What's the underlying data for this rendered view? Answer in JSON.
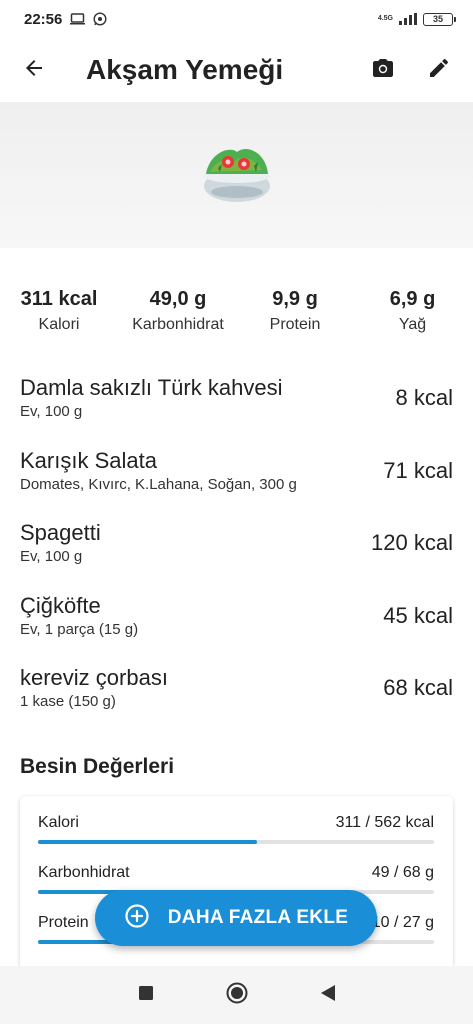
{
  "status_bar": {
    "time": "22:56",
    "network_label": "4.5G",
    "battery": "35",
    "icons": [
      "screen-icon",
      "whatsapp-icon",
      "signal-icon",
      "battery-icon"
    ]
  },
  "app_bar": {
    "title": "Akşam Yemeği",
    "icons": [
      "back-arrow-icon",
      "camera-icon",
      "edit-pencil-icon"
    ]
  },
  "hero": {
    "icon": "salad-icon"
  },
  "summary": [
    {
      "value": "311 kcal",
      "label": "Kalori"
    },
    {
      "value": "49,0 g",
      "label": "Karbonhidrat"
    },
    {
      "value": "9,9 g",
      "label": "Protein"
    },
    {
      "value": "6,9 g",
      "label": "Yağ"
    }
  ],
  "foods": [
    {
      "name": "Damla sakızlı Türk kahvesi",
      "detail": "Ev, 100 g",
      "kcal": "8 kcal"
    },
    {
      "name": "Karışık Salata",
      "detail": "Domates, Kıvırc, K.Lahana, Soğan, 300 g",
      "kcal": "71 kcal"
    },
    {
      "name": "Spagetti",
      "detail": "Ev, 100 g",
      "kcal": "120 kcal"
    },
    {
      "name": "Çiğköfte",
      "detail": "Ev, 1 parça (15 g)",
      "kcal": "45 kcal"
    },
    {
      "name": "kereviz çorbası",
      "detail": "1 kase (150 g)",
      "kcal": "68 kcal"
    }
  ],
  "nutrition": {
    "title": "Besin Değerleri",
    "rows": [
      {
        "label": "Kalori",
        "value": "311 / 562 kcal",
        "progress": 0.553
      },
      {
        "label": "Karbonhidrat",
        "value": "49 / 68 g",
        "progress": 0.72
      },
      {
        "label": "Protein",
        "value": "10 / 27 g",
        "progress": 0.37
      }
    ]
  },
  "fab": {
    "label": "DAHA FAZLA EKLE",
    "icon": "plus-circle-icon"
  },
  "nav_bar": {
    "icons": [
      "recents-square-icon",
      "home-circle-icon",
      "back-triangle-icon"
    ]
  },
  "colors": {
    "accent": "#1a8fd8",
    "progress_fill": "#1a8fd2",
    "progress_track": "#e2e2e2"
  }
}
